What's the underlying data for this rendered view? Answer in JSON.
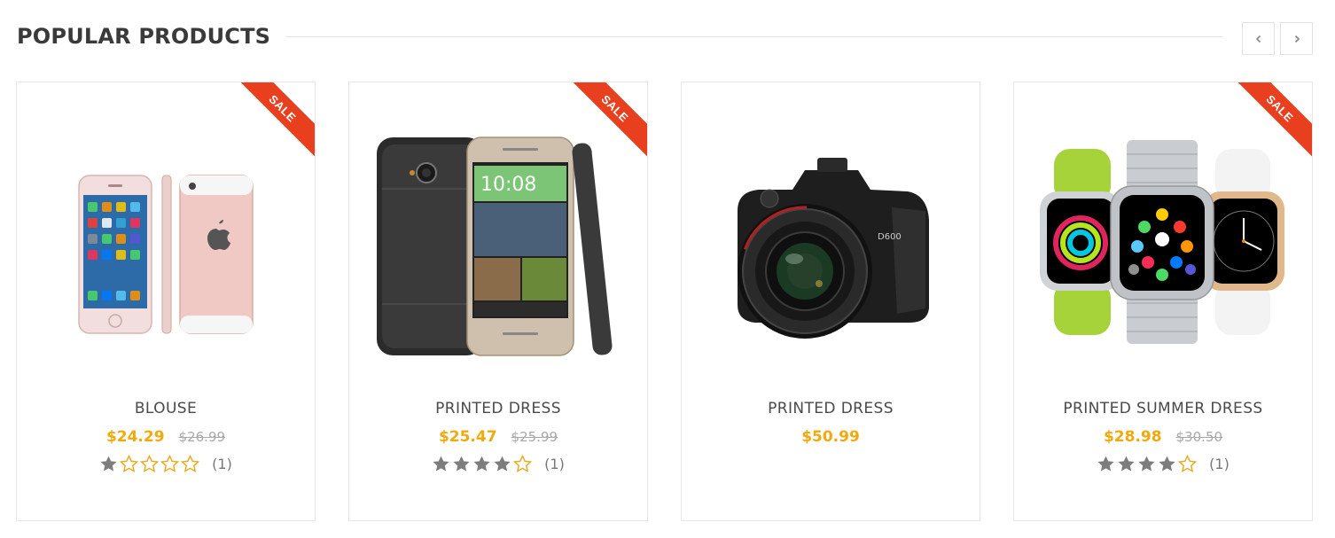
{
  "section": {
    "title": "POPULAR PRODUCTS",
    "prev_icon": "chevron-left-icon",
    "next_icon": "chevron-right-icon"
  },
  "colors": {
    "sale_ribbon": "#e8401f",
    "price": "#f2a90b",
    "old_price": "#a8a8a8",
    "star_filled": "#7d7d7d",
    "star_empty_outline": "#e6a91b"
  },
  "products": [
    {
      "name": "BLOUSE",
      "price": "$24.29",
      "old_price": "$26.99",
      "sale_label": "SALE",
      "rating": 1,
      "reviews": "(1)",
      "image": "smartphone-pink-image"
    },
    {
      "name": "PRINTED DRESS",
      "price": "$25.47",
      "old_price": "$25.99",
      "sale_label": "SALE",
      "rating": 4,
      "reviews": "(1)",
      "image": "smartphone-dark-image"
    },
    {
      "name": "PRINTED DRESS",
      "price": "$50.99",
      "old_price": "",
      "sale_label": "",
      "rating": 0,
      "reviews": "",
      "image": "dslr-camera-image"
    },
    {
      "name": "PRINTED SUMMER DRESS",
      "price": "$28.98",
      "old_price": "$30.50",
      "sale_label": "SALE",
      "rating": 4,
      "reviews": "(1)",
      "image": "smartwatch-image"
    }
  ]
}
